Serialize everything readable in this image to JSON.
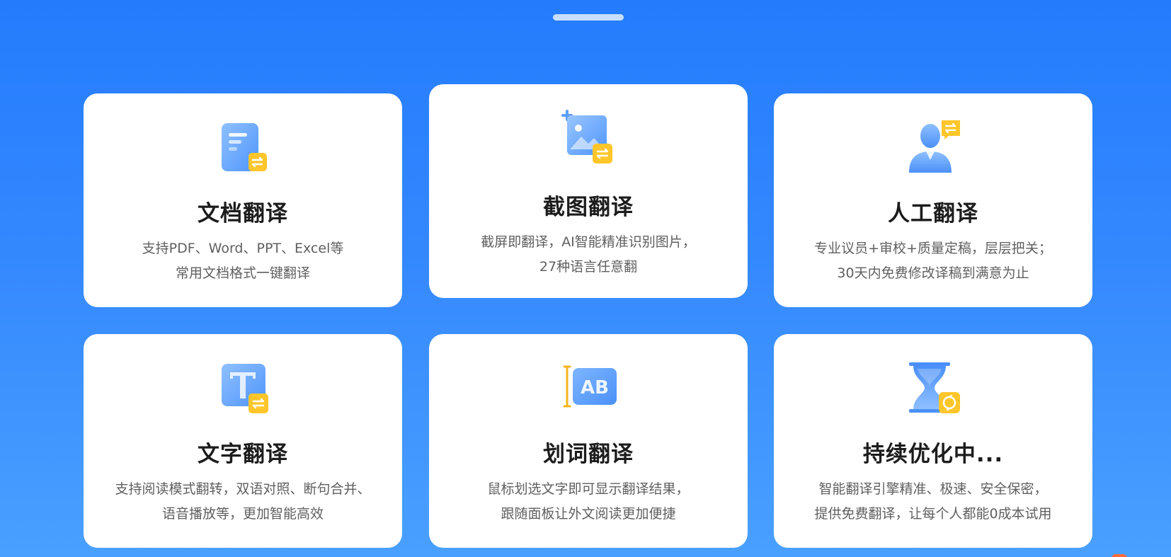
{
  "cards": [
    {
      "icon": "document-translate-icon",
      "title": "文档翻译",
      "desc_line1": "支持PDF、Word、PPT、Excel等",
      "desc_line2": "常用文档格式一键翻译"
    },
    {
      "icon": "screenshot-translate-icon",
      "title": "截图翻译",
      "desc_line1": "截屏即翻译，AI智能精准识别图片，",
      "desc_line2": "27种语言任意翻"
    },
    {
      "icon": "human-translate-icon",
      "title": "人工翻译",
      "desc_line1": "专业议员+审校+质量定稿，层层把关；",
      "desc_line2": "30天内免费修改译稿到满意为止"
    },
    {
      "icon": "text-translate-icon",
      "title": "文字翻译",
      "desc_line1": "支持阅读模式翻转，双语对照、断句合并、",
      "desc_line2": "语音播放等，更加智能高效"
    },
    {
      "icon": "word-select-translate-icon",
      "title": "划词翻译",
      "desc_line1": "鼠标划选文字即可显示翻译结果，",
      "desc_line2": "跟随面板让外文阅读更加便捷"
    },
    {
      "icon": "hourglass-icon",
      "title": "持续优化中...",
      "desc_line1": "智能翻译引擎精准、极速、安全保密，",
      "desc_line2": "提供免费翻译，让每个人都能0成本试用"
    }
  ],
  "colors": {
    "background_top": "#247cfd",
    "background_bottom": "#4aa0ff",
    "icon_blue": "#6aa8ff",
    "badge_yellow": "#ffc62b"
  }
}
